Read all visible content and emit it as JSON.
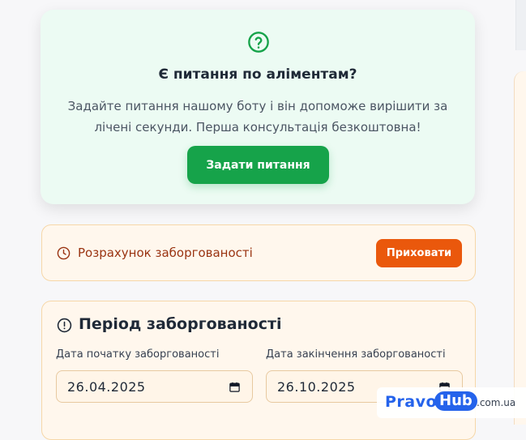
{
  "help": {
    "title": "Є питання по аліментам?",
    "text": "Задайте питання нашому боту і він допоможе вирішити за лічені секунди. Перша консультація безкоштовна!",
    "button_label": "Задати питання"
  },
  "calc": {
    "title": "Розрахунок заборгованості",
    "hide_label": "Приховати"
  },
  "period": {
    "title": "Період заборгованості",
    "start_label": "Дата початку заборгованості",
    "start_value": "26.04.2025",
    "end_label": "Дата закінчення заборгованості",
    "end_value": "26.10.2025"
  },
  "brand": {
    "pravo": "Pravo",
    "hub": "Hub",
    "domain": ".com.ua"
  },
  "colors": {
    "accent_green": "#16a34a",
    "accent_orange": "#ea580c",
    "brand_blue": "#2563eb"
  }
}
